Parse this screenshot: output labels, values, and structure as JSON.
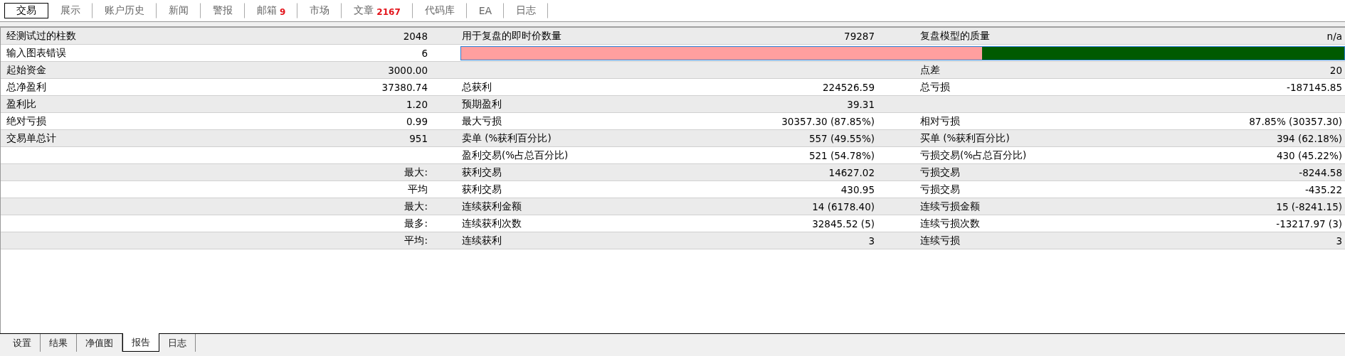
{
  "top_tabs": [
    {
      "label": "交易",
      "selected": true
    },
    {
      "label": "展示",
      "selected": false
    },
    {
      "label": "账户历史",
      "selected": false
    },
    {
      "label": "新闻",
      "selected": false
    },
    {
      "label": "警报",
      "selected": false
    },
    {
      "label": "邮箱",
      "badge": "9",
      "selected": false
    },
    {
      "label": "市场",
      "selected": false
    },
    {
      "label": "文章",
      "badge": "2167",
      "selected": false
    },
    {
      "label": "代码库",
      "selected": false
    },
    {
      "label": "EA",
      "selected": false
    },
    {
      "label": "日志",
      "selected": false
    }
  ],
  "report_rows": [
    {
      "kind": "cells",
      "cells": [
        {
          "label": "经测试过的柱数",
          "value": "2048"
        },
        {
          "label": "用于复盘的即时价数量",
          "value": "79287"
        },
        {
          "label": "复盘模型的质量",
          "value": "n/a"
        }
      ]
    },
    {
      "kind": "bar",
      "cells": [
        {
          "label": "输入图表错误",
          "value": "6"
        }
      ],
      "level": 0.59
    },
    {
      "kind": "cells",
      "cells": [
        {
          "label": "起始资金",
          "value": "3000.00"
        },
        {},
        {
          "label": "点差",
          "value": "20"
        }
      ]
    },
    {
      "kind": "cells",
      "cells": [
        {
          "label": "总净盈利",
          "value": "37380.74"
        },
        {
          "label": "总获利",
          "value": "224526.59"
        },
        {
          "label": "总亏损",
          "value": "-187145.85"
        }
      ]
    },
    {
      "kind": "cells",
      "cells": [
        {
          "label": "盈利比",
          "value": "1.20"
        },
        {
          "label": "预期盈利",
          "value": "39.31"
        },
        {}
      ]
    },
    {
      "kind": "cells",
      "cells": [
        {
          "label": "绝对亏损",
          "value": "0.99"
        },
        {
          "label": "最大亏损",
          "value": "30357.30 (87.85%)"
        },
        {
          "label": "相对亏损",
          "value": "87.85% (30357.30)"
        }
      ]
    },
    {
      "kind": "cells",
      "cells": [
        {
          "label": "交易单总计",
          "value": "951"
        },
        {
          "label": "卖单 (%获利百分比)",
          "value": "557 (49.55%)"
        },
        {
          "label": "买单 (%获利百分比)",
          "value": "394 (62.18%)"
        }
      ]
    },
    {
      "kind": "cells",
      "cells": [
        {},
        {
          "label": "盈利交易(%占总百分比)",
          "value": "521 (54.78%)"
        },
        {
          "label": "亏损交易(%占总百分比)",
          "value": "430 (45.22%)"
        }
      ]
    },
    {
      "kind": "cells",
      "cells": [
        {
          "value": "最大:"
        },
        {
          "label": "获利交易",
          "value": "14627.02"
        },
        {
          "label": "亏损交易",
          "value": "-8244.58"
        }
      ]
    },
    {
      "kind": "cells",
      "cells": [
        {
          "value": "平均"
        },
        {
          "label": "获利交易",
          "value": "430.95"
        },
        {
          "label": "亏损交易",
          "value": "-435.22"
        }
      ]
    },
    {
      "kind": "cells",
      "cells": [
        {
          "value": "最大:"
        },
        {
          "label": "连续获利金额",
          "value": "14 (6178.40)"
        },
        {
          "label": "连续亏损金额",
          "value": "15 (-8241.15)"
        }
      ]
    },
    {
      "kind": "cells",
      "cells": [
        {
          "value": "最多:"
        },
        {
          "label": "连续获利次数",
          "value": "32845.52 (5)"
        },
        {
          "label": "连续亏损次数",
          "value": "-13217.97 (3)"
        }
      ]
    },
    {
      "kind": "cells",
      "cells": [
        {
          "value": "平均:"
        },
        {
          "label": "连续获利",
          "value": "3"
        },
        {
          "label": "连续亏损",
          "value": "3"
        }
      ]
    }
  ],
  "bottom_tabs": [
    {
      "label": "设置",
      "selected": false
    },
    {
      "label": "结果",
      "selected": false
    },
    {
      "label": "净值图",
      "selected": false
    },
    {
      "label": "报告",
      "selected": true
    },
    {
      "label": "日志",
      "selected": false
    }
  ]
}
